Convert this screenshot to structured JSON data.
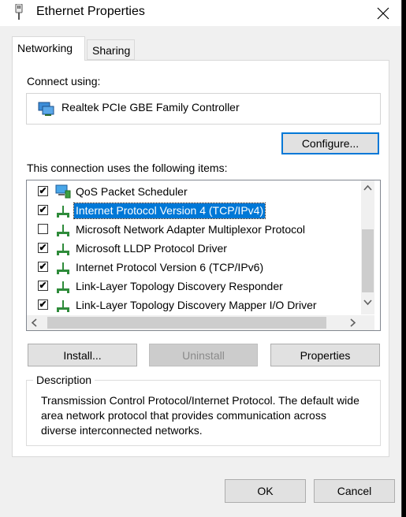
{
  "window": {
    "title": "Ethernet Properties"
  },
  "tabs": [
    {
      "label": "Networking"
    },
    {
      "label": "Sharing"
    }
  ],
  "connect": {
    "label": "Connect using:",
    "adapter": "Realtek PCIe GBE Family Controller",
    "configure_label": "Configure..."
  },
  "items_section": {
    "label": "This connection uses the following items:",
    "items": [
      {
        "label": "QoS Packet Scheduler",
        "checked": true,
        "icon": "qos-monitor-icon"
      },
      {
        "label": "Internet Protocol Version 4 (TCP/IPv4)",
        "checked": true,
        "selected": true,
        "icon": "network-protocol-icon"
      },
      {
        "label": "Microsoft Network Adapter Multiplexor Protocol",
        "checked": false,
        "icon": "network-protocol-icon"
      },
      {
        "label": "Microsoft LLDP Protocol Driver",
        "checked": true,
        "icon": "network-protocol-icon"
      },
      {
        "label": "Internet Protocol Version 6 (TCP/IPv6)",
        "checked": true,
        "icon": "network-protocol-icon"
      },
      {
        "label": "Link-Layer Topology Discovery Responder",
        "checked": true,
        "icon": "network-protocol-icon"
      },
      {
        "label": "Link-Layer Topology Discovery Mapper I/O Driver",
        "checked": true,
        "icon": "network-protocol-icon"
      }
    ]
  },
  "buttons": {
    "install": "Install...",
    "uninstall": "Uninstall",
    "properties": "Properties",
    "ok": "OK",
    "cancel": "Cancel"
  },
  "description": {
    "legend": "Description",
    "text": "Transmission Control Protocol/Internet Protocol. The default wide area network protocol that provides communication across diverse interconnected networks."
  },
  "colors": {
    "accent": "#0078d7",
    "selection": "#0078d7",
    "window_bg": "#f0f0f0"
  }
}
